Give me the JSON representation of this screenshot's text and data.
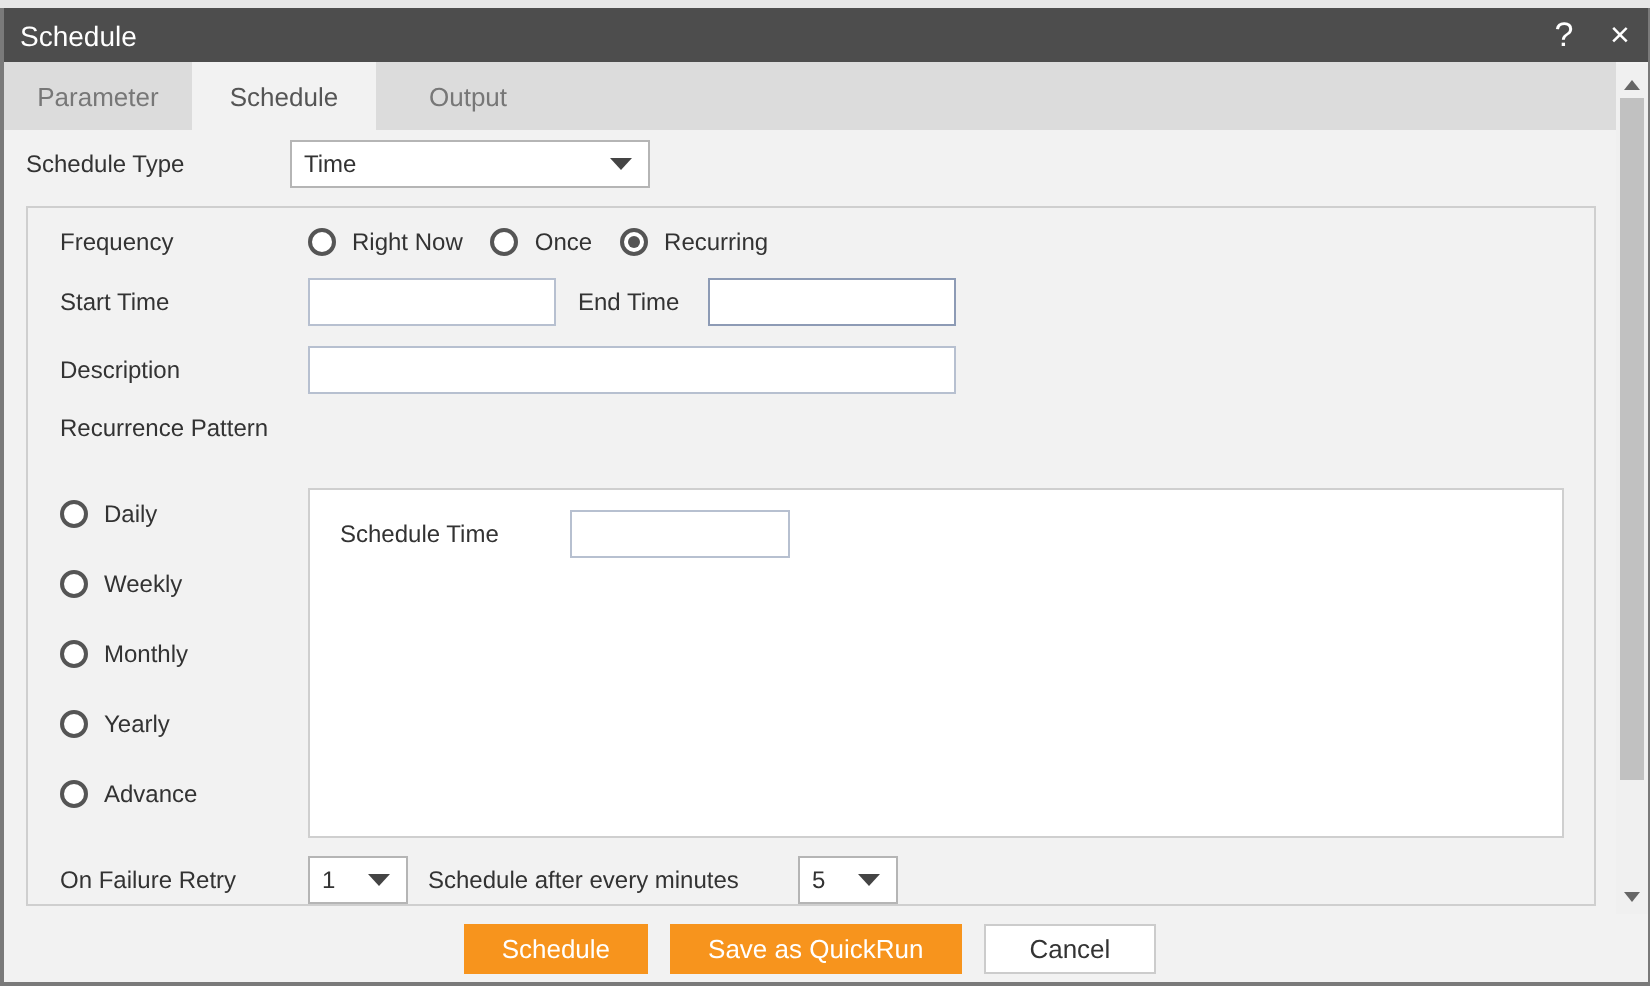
{
  "window": {
    "title": "Schedule",
    "help_button": "?",
    "close_button": "×"
  },
  "tabs": [
    {
      "label": "Parameter",
      "selected": false
    },
    {
      "label": "Schedule",
      "selected": true
    },
    {
      "label": "Output",
      "selected": false
    }
  ],
  "schedule_type": {
    "label": "Schedule Type",
    "value": "Time"
  },
  "frequency": {
    "label": "Frequency",
    "options": [
      {
        "label": "Right Now",
        "selected": false
      },
      {
        "label": "Once",
        "selected": false
      },
      {
        "label": "Recurring",
        "selected": true
      }
    ]
  },
  "start_time": {
    "label": "Start Time"
  },
  "end_time": {
    "label": "End Time"
  },
  "description": {
    "label": "Description"
  },
  "recurrence_pattern": {
    "label": "Recurrence Pattern",
    "options": [
      {
        "label": "Daily",
        "selected": false
      },
      {
        "label": "Weekly",
        "selected": false
      },
      {
        "label": "Monthly",
        "selected": false
      },
      {
        "label": "Yearly",
        "selected": false
      },
      {
        "label": "Advance",
        "selected": false
      }
    ],
    "schedule_time": {
      "label": "Schedule Time"
    }
  },
  "on_failure_retry": {
    "label": "On Failure Retry",
    "value": "1"
  },
  "schedule_after": {
    "label": "Schedule after every minutes",
    "value": "5"
  },
  "buttons": [
    {
      "label": "Schedule",
      "kind": "primary"
    },
    {
      "label": "Save as QuickRun",
      "kind": "primary"
    },
    {
      "label": "Cancel",
      "kind": "secondary"
    }
  ]
}
